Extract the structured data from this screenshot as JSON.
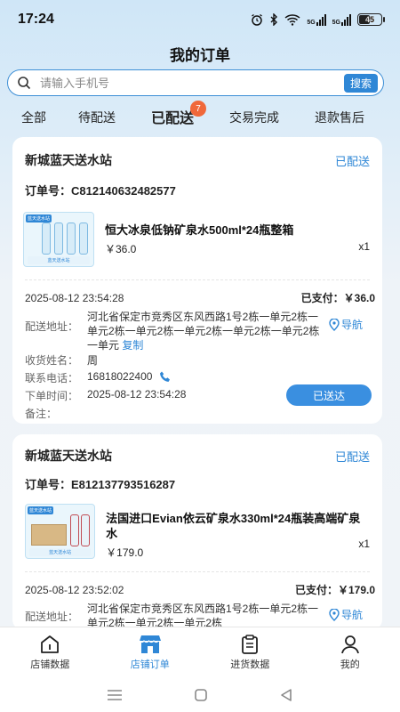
{
  "status_bar": {
    "time": "17:24",
    "network_labels": [
      "5G",
      "5G"
    ],
    "battery": "45"
  },
  "page": {
    "title": "我的订单"
  },
  "search": {
    "placeholder": "请输入手机号",
    "button": "搜索"
  },
  "tabs": [
    {
      "label": "全部"
    },
    {
      "label": "待配送"
    },
    {
      "label": "已配送",
      "active": true,
      "badge": "7"
    },
    {
      "label": "交易完成"
    },
    {
      "label": "退款售后"
    }
  ],
  "orders": [
    {
      "station": "新城蓝天送水站",
      "status": "已配送",
      "order_no": "订单号：C812140632482577",
      "thumb_top": "蓝天送水站",
      "thumb_bottom": "蓝天送水站",
      "product_name": "恒大冰泉低钠矿泉水500ml*24瓶整箱",
      "price": "￥36.0",
      "qty": "x1",
      "time": "2025-08-12 23:54:28",
      "paid": "已支付：￥36.0",
      "address_label": "配送地址：",
      "address": "河北省保定市竞秀区东风西路1号2栋一单元2栋一单元2栋一单元2栋一单元2栋一单元2栋一单元2栋一单元",
      "copy": "复制",
      "nav": "导航",
      "name_label": "收货姓名：",
      "name": "周",
      "phone_label": "联系电话：",
      "phone": "16818022400",
      "order_time_label": "下单时间：",
      "order_time": "2025-08-12 23:54:28",
      "note_label": "备注：",
      "action": "已送达"
    },
    {
      "station": "新城蓝天送水站",
      "status": "已配送",
      "order_no": "订单号：E812137793516287",
      "thumb_top": "蓝天送水站",
      "thumb_bottom": "蓝天送水站",
      "product_name": "法国进口Evian依云矿泉水330ml*24瓶装高端矿泉水",
      "price": "￥179.0",
      "qty": "x1",
      "time": "2025-08-12 23:52:02",
      "paid": "已支付：￥179.0",
      "address_label": "配送地址：",
      "address": "河北省保定市竞秀区东风西路1号2栋一单元2栋一单元2栋一单元2栋一单元2栋",
      "nav": "导航"
    }
  ],
  "bottom_nav": [
    {
      "label": "店铺数据",
      "icon": "home-icon"
    },
    {
      "label": "店铺订单",
      "icon": "shop-icon",
      "active": true
    },
    {
      "label": "进货数据",
      "icon": "clipboard-icon"
    },
    {
      "label": "我的",
      "icon": "user-icon"
    }
  ],
  "colors": {
    "accent": "#2f87d6",
    "badge": "#f0683a"
  }
}
